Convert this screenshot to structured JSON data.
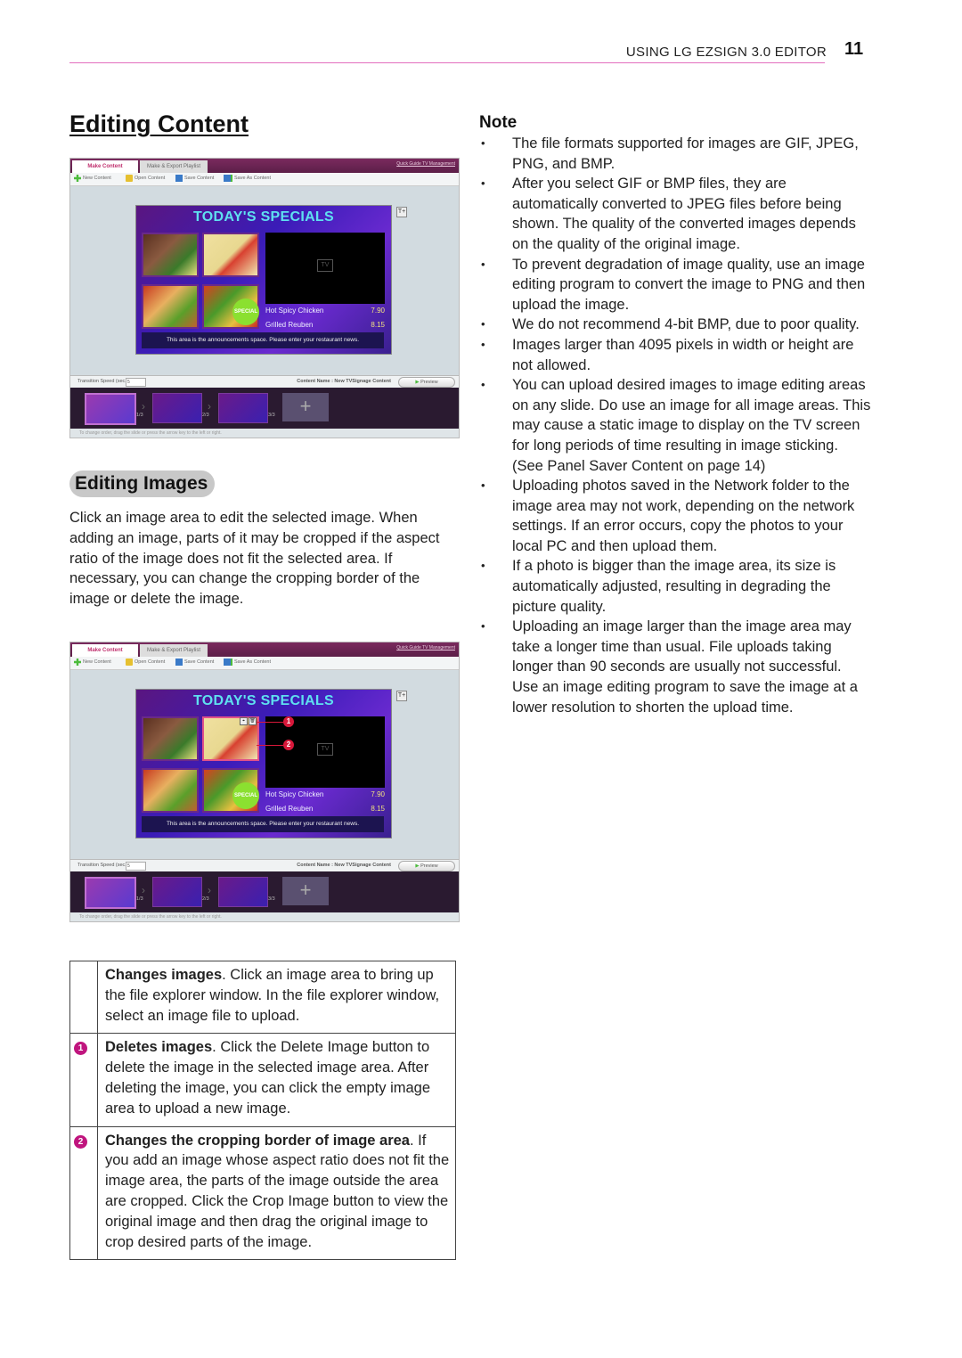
{
  "header": {
    "running_head": "USING LG EZSIGN 3.0 EDITOR",
    "page_number": "11",
    "rule_color": "#e36fbf"
  },
  "section": {
    "title": "Editing Content",
    "subsection_title": "Editing Images",
    "intro": "Click an image area to edit the selected image. When adding an image, parts of it may be cropped if the aspect ratio of the image does not fit the selected area. If necessary, you can change the cropping border of the image or delete the image."
  },
  "editor_screenshot": {
    "tabs": [
      "Make Content",
      "Make & Export Playlist"
    ],
    "quick_links": "Quick Guide  TV Management",
    "toolbar": [
      "New Content",
      "Open Content",
      "Save Content",
      "Save As Content"
    ],
    "slide": {
      "title": "TODAY'S SPECIALS",
      "tv_label": "TV",
      "menu": [
        {
          "item": "Hot Spicy Chicken",
          "price": "7.90"
        },
        {
          "item": "Grilled Reuben",
          "price": "8.15"
        }
      ],
      "badge": "SPECIAL",
      "announcement": "This area is the announcements space. Please enter your restaurant news.",
      "text_tool_icon": "T+"
    },
    "transition_label": "Transition Speed (sec.) :",
    "transition_value": "5",
    "content_name": "Content Name : New TVSignage Content",
    "preview_label": "Preview",
    "slides": [
      {
        "label": "1/3",
        "selected": true
      },
      {
        "label": "2/3",
        "selected": false
      },
      {
        "label": "3/3",
        "selected": false
      }
    ],
    "add_slide_symbol": "+",
    "status_text": "To change order, drag the slide or press the arrow key to the left or right.",
    "callouts": [
      "1",
      "2"
    ],
    "accent_color": "#d8183a"
  },
  "legend": [
    {
      "marker": "",
      "bold": "Changes images",
      "text": ". Click an image area to bring up the file explorer window. In the file explorer window, select an image file to upload."
    },
    {
      "marker": "1",
      "bold": "Deletes images",
      "text": ". Click the Delete Image button to delete the image in the selected image area. After deleting the image, you can click the empty image area to upload a new image."
    },
    {
      "marker": "2",
      "bold": "Changes the cropping border of image area",
      "text": ". If you add an image whose aspect ratio does not fit the image area, the parts of the image outside the area are cropped. Click the Crop Image button to view the original image and then drag the original image to crop desired parts of the image."
    }
  ],
  "legend_badge_color": "#c0157e",
  "note": {
    "title": "Note",
    "items": [
      "The file formats supported for images are GIF, JPEG, PNG, and BMP.",
      "After you select GIF or BMP files, they are automatically converted to JPEG files before being shown. The quality of the converted images depends on the quality of the original image.",
      "To prevent degradation of image quality, use an image editing program to convert the image to PNG and then upload the image.",
      "We do not recommend 4-bit BMP, due to poor quality.",
      "Images larger than 4095 pixels in width or height are not allowed.",
      "You can upload desired images to image editing areas on any slide. Do use an image for all image areas. This may cause a static image to display on the TV screen for long periods of time resulting in image sticking. (See Panel Saver Content on page 14)",
      "Uploading photos saved in the Network folder to the image area may not work, depending on the network settings. If an error occurs, copy the photos to your local PC and then upload them.",
      "If a photo is bigger than the image area, its size is automatically adjusted, resulting in degrading the picture quality.",
      "Uploading an image larger than the image area may take a longer time than usual. File uploads taking longer than 90 seconds are usually not successful. Use an image editing program to save the image at a lower resolution to shorten the upload time."
    ]
  }
}
